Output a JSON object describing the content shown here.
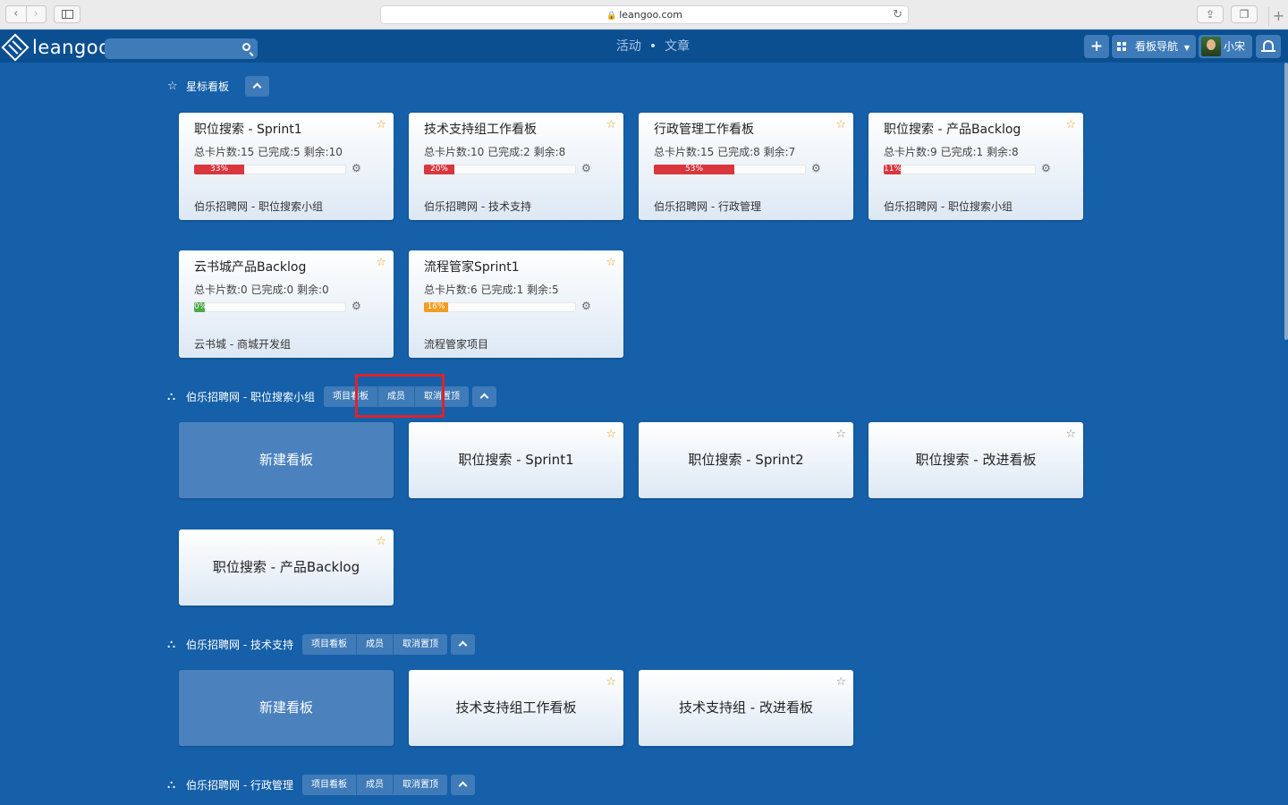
{
  "browser": {
    "url": "leangoo.com",
    "lock": "🔒",
    "reload": "↻",
    "new_tab": "+"
  },
  "header": {
    "logo": "leangoo",
    "search_placeholder": "",
    "nav_activity": "活动",
    "nav_separator": "•",
    "nav_articles": "文章",
    "add_label": "+",
    "board_nav": "看板导航",
    "user_name": "小宋"
  },
  "starred": {
    "title": "星标看板",
    "cards": [
      {
        "title": "职位搜索 - Sprint1",
        "stats": "总卡片数:15 已完成:5 剩余:10",
        "percent": 33,
        "percent_label": "33%",
        "team": "伯乐招聘网 - 职位搜索小组",
        "starred": true
      },
      {
        "title": "技术支持组工作看板",
        "stats": "总卡片数:10 已完成:2 剩余:8",
        "percent": 20,
        "percent_label": "20%",
        "team": "伯乐招聘网 - 技术支持",
        "starred": true
      },
      {
        "title": "行政管理工作看板",
        "stats": "总卡片数:15 已完成:8 剩余:7",
        "percent": 53,
        "percent_label": "53%",
        "team": "伯乐招聘网 - 行政管理",
        "starred": true
      },
      {
        "title": "职位搜索 - 产品Backlog",
        "stats": "总卡片数:9 已完成:1 剩余:8",
        "percent": 11,
        "percent_label": "11%",
        "team": "伯乐招聘网 - 职位搜索小组",
        "starred": true
      },
      {
        "title": "云书城产品Backlog",
        "stats": "总卡片数:0 已完成:0 剩余:0",
        "percent": 0,
        "percent_label": "0%",
        "team": "云书城 - 商城开发组",
        "starred": true
      },
      {
        "title": "流程管家Sprint1",
        "stats": "总卡片数:6 已完成:1 剩余:5",
        "percent": 16,
        "percent_label": "16%",
        "team": "流程管家项目",
        "starred": true
      }
    ]
  },
  "projects": [
    {
      "name": "伯乐招聘网 - 职位搜索小组",
      "btn_boards": "项目看板",
      "btn_members": "成员",
      "btn_unpin": "取消置顶",
      "new_board": "新建看板",
      "boards": [
        {
          "title": "职位搜索 - Sprint1",
          "starred": true
        },
        {
          "title": "职位搜索 - Sprint2",
          "starred": false
        },
        {
          "title": "职位搜索 - 改进看板",
          "starred": false
        },
        {
          "title": "职位搜索 - 产品Backlog",
          "starred": true
        }
      ]
    },
    {
      "name": "伯乐招聘网 - 技术支持",
      "btn_boards": "项目看板",
      "btn_members": "成员",
      "btn_unpin": "取消置顶",
      "new_board": "新建看板",
      "boards": [
        {
          "title": "技术支持组工作看板",
          "starred": true
        },
        {
          "title": "技术支持组 - 改进看板",
          "starred": false
        }
      ]
    },
    {
      "name": "伯乐招聘网 - 行政管理",
      "btn_boards": "项目看板",
      "btn_members": "成员",
      "btn_unpin": "取消置顶"
    }
  ],
  "icons": {
    "star_on": "☆",
    "star_off": "☆",
    "gear": "⚙",
    "group": "⛬",
    "star_section": "☆"
  },
  "colors": {
    "page_bg": "#1560a8",
    "header_bg": "#0b4f91",
    "progress_red": "#d9363e",
    "progress_green": "#4ba84a",
    "progress_orange": "#f39c22",
    "star_active": "#e7a125",
    "highlight": "#e0222a"
  }
}
